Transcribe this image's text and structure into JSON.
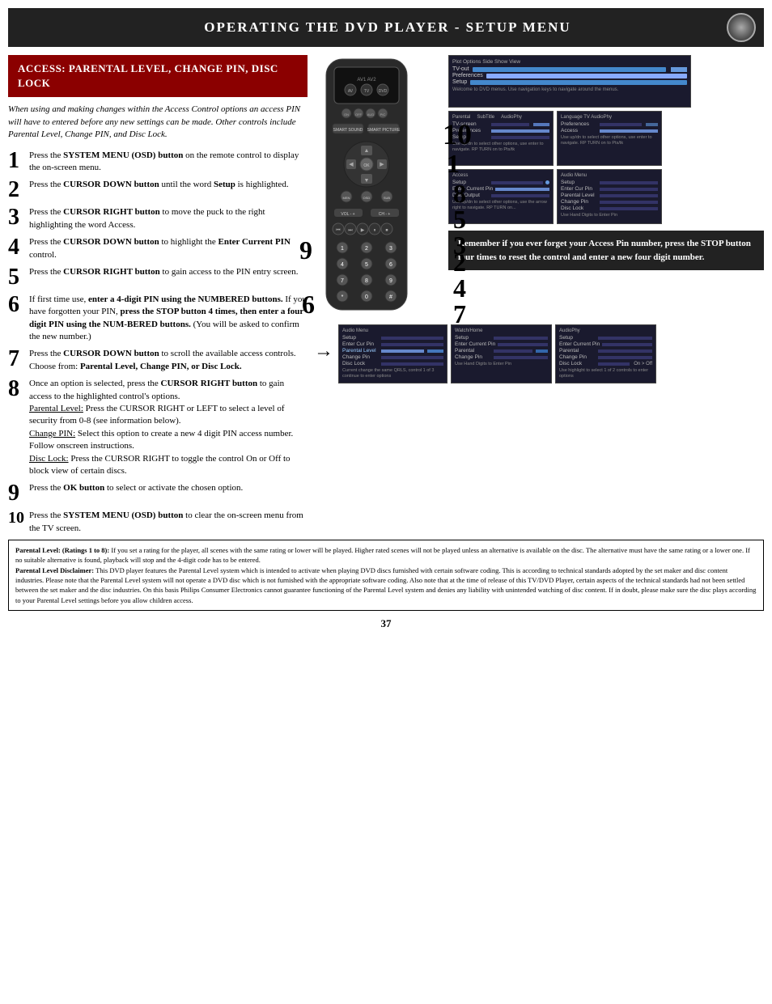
{
  "page": {
    "title": "OPERATING THE DVD PLAYER - SETUP MENU",
    "page_number": "37"
  },
  "section": {
    "header": "ACCESS: PARENTAL LEVEL, CHANGE PIN, DISC LOCK",
    "intro": "When using and making changes within the Access Control options an access PIN will have to entered before any new settings can be made. Other controls include Parental Level, Change PIN, and Disc Lock."
  },
  "steps": [
    {
      "number": "1",
      "text": "Press the SYSTEM MENU (OSD) button on the remote control to display the on-screen menu."
    },
    {
      "number": "2",
      "text": "Press the CURSOR DOWN button until the word Setup is highlighted."
    },
    {
      "number": "3",
      "text": "Press the CURSOR RIGHT button to move the puck to the right highlighting the word Access."
    },
    {
      "number": "4",
      "text": "Press the CURSOR DOWN button to highlight the Enter Current PIN control."
    },
    {
      "number": "5",
      "text": "Press the CURSOR RIGHT button to gain access to the PIN entry screen."
    },
    {
      "number": "6",
      "text": "If first time use, enter a 4-digit PIN using the NUMBERED buttons. If you have forgotten your PIN, press the STOP button 4 times, then enter a four digit PIN using the NUM-BERED buttons. (You will be asked to confirm the new number.)"
    },
    {
      "number": "7",
      "text": "Press the CURSOR DOWN button to scroll the available access controls. Choose from: Parental Level, Change PIN, or Disc Lock."
    },
    {
      "number": "8",
      "text": "Once an option is selected, press the CURSOR RIGHT button to gain access to the highlighted control's options. Parental Level: Press the CURSOR RIGHT or LEFT to select a level of security from 0-8 (see information below). Change PIN: Select this option to create a new 4 digit PIN access number. Follow onscreen instructions. Disc Lock: Press the CURSOR RIGHT to toggle the control On or Off to block view of certain discs."
    },
    {
      "number": "9",
      "text": "Press the OK button to select or activate the chosen option."
    },
    {
      "number": "10",
      "text": "Press the SYSTEM MENU (OSD) button to clear the on-screen menu from the TV screen."
    }
  ],
  "remember_box": {
    "text": "Remember if you ever forget your Access Pin number, press the STOP button four times to reset the control and enter a new four digit number."
  },
  "disclaimer": {
    "parental_level_title": "Parental Level: (Ratings 1 to 8):",
    "parental_level_text": "If you set a rating for the player, all scenes with the same rating or lower will be played. Higher rated scenes will not be played unless an alternative is available on the disc. The alternative must have the same rating or a lower one. If no suitable alternative is found, playback will stop and the 4-digit code has to be entered.",
    "disclaimer_title": "Parental Level Disclaimer:",
    "disclaimer_text": "This DVD player features the Parental Level system which is intended to activate when playing DVD discs furnished with certain software coding. This is according to technical standards adopted by the set maker and disc content industries. Please note that the Parental Level system will not operate a DVD disc which is not furnished with the appropriate software coding. Also note that at the time of release of this TV/DVD Player, certain aspects of the technical standards had not been settled between the set maker and the disc industries. On this basis Philips Consumer Electronics cannot guarantee functioning of the Parental Level system and denies any liability with unintended watching of disc content. If in doubt, please make sure the disc plays according to your Parental Level settings before you allow children access."
  },
  "screen_labels": {
    "s1_title": "Plot Options Side Show View",
    "welcome_text": "Welcome to DVD menus. Use navigation keys to navigate around the menus.",
    "access_menu": "Access",
    "preferences": "Preferences",
    "setup": "Setup",
    "parental_level": "Parental Level",
    "change_pin": "Change Pin",
    "parental": "Parental",
    "disc_lock": "Disc Lock",
    "enter_current_pin": "Enter Current Pin",
    "audio_menu": "Audio Menu",
    "sub_title": "Sub Title",
    "audio_phy": "Audio Phy"
  }
}
